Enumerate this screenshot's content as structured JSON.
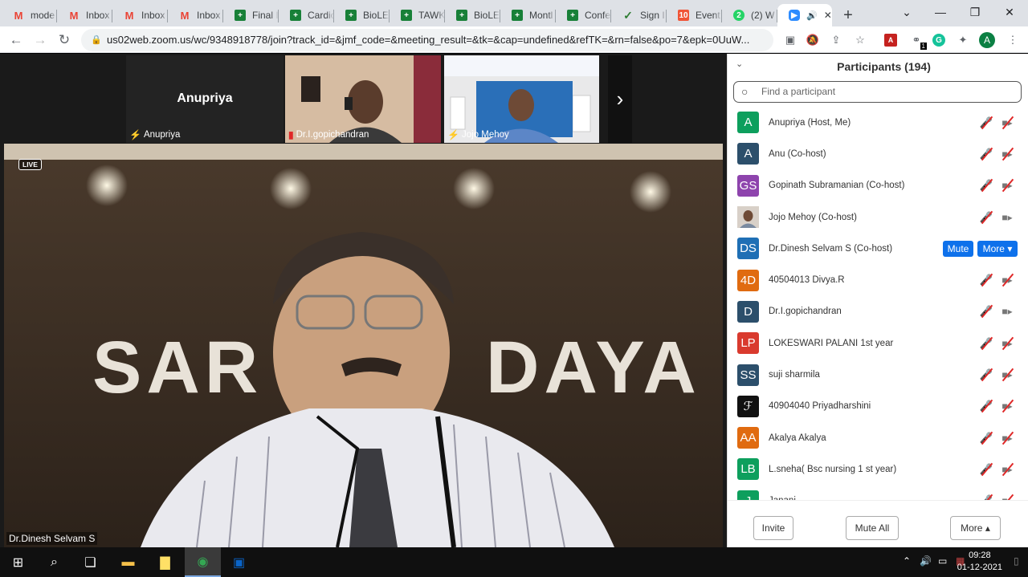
{
  "browser": {
    "tabs": [
      {
        "title": "mode",
        "favicon": "gmail-icon",
        "glyph": "M",
        "kind": "gmail"
      },
      {
        "title": "Inbox",
        "favicon": "gmail-icon",
        "glyph": "M",
        "kind": "gmail"
      },
      {
        "title": "Inbox",
        "favicon": "gmail-icon",
        "glyph": "M",
        "kind": "gmail"
      },
      {
        "title": "Inbox",
        "favicon": "gmail-icon",
        "glyph": "M",
        "kind": "gmail"
      },
      {
        "title": "Final I",
        "favicon": "sheets-icon",
        "glyph": "+",
        "kind": "sheet"
      },
      {
        "title": "Cardic",
        "favicon": "sheets-icon",
        "glyph": "+",
        "kind": "sheet"
      },
      {
        "title": "BioLE",
        "favicon": "sheets-icon",
        "glyph": "+",
        "kind": "sheet"
      },
      {
        "title": "TAWK",
        "favicon": "sheets-icon",
        "glyph": "+",
        "kind": "sheet"
      },
      {
        "title": "BioLE",
        "favicon": "sheets-icon",
        "glyph": "+",
        "kind": "sheet"
      },
      {
        "title": "Montl",
        "favicon": "sheets-icon",
        "glyph": "+",
        "kind": "sheet"
      },
      {
        "title": "Confe",
        "favicon": "sheets-icon",
        "glyph": "+",
        "kind": "sheet"
      },
      {
        "title": "Sign I",
        "favicon": "signup-icon",
        "glyph": "✓",
        "kind": "sign"
      },
      {
        "title": "Event",
        "favicon": "event-icon",
        "glyph": "10",
        "kind": "event"
      },
      {
        "title": "(2) W",
        "favicon": "whatsapp-icon",
        "glyph": "2",
        "kind": "wa"
      }
    ],
    "active_tab": {
      "favicon": "zoom-icon",
      "speaker": "🔊",
      "close": "✕"
    },
    "new_tab": "+",
    "url": "us02web.zoom.us/wc/9348918778/join?track_id=&jmf_code=&meeting_result=&tk=&cap=undefined&refTK=&rn=false&po=7&epk=0UuW...",
    "profile_initial": "A",
    "ext_badge": "1"
  },
  "meeting": {
    "thumbnails": [
      {
        "name": "Anupriya",
        "big_label": "Anupriya"
      },
      {
        "name": "Dr.I.gopichandran"
      },
      {
        "name": "Jojo Mehoy"
      }
    ],
    "live_badge": "LIVE",
    "active_speaker": "Dr.Dinesh Selvam S"
  },
  "participants": {
    "title": "Participants (194)",
    "search_placeholder": "Find a participant",
    "list": [
      {
        "initials": "A",
        "color": "#0d9f5d",
        "name": "Anupriya (Host, Me)",
        "mic": "muted",
        "cam": "off"
      },
      {
        "initials": "A",
        "color": "#2c4f6b",
        "name": "Anu (Co-host)",
        "mic": "muted",
        "cam": "off"
      },
      {
        "initials": "GS",
        "color": "#8e44ad",
        "name": "Gopinath Subramanian (Co-host)",
        "mic": "muted",
        "cam": "off"
      },
      {
        "initials": "",
        "color": "#8a7a70",
        "name": "Jojo Mehoy (Co-host)",
        "mic": "muted",
        "cam": "on",
        "photo": true
      },
      {
        "initials": "DS",
        "color": "#1f6fb5",
        "name": "Dr.Dinesh Selvam S (Co-host)",
        "buttons": [
          "Mute",
          "More ▾"
        ]
      },
      {
        "initials": "4D",
        "color": "#e06b10",
        "name": "40504013 Divya.R",
        "mic": "muted",
        "cam": "off"
      },
      {
        "initials": "D",
        "color": "#2c4f6b",
        "name": "Dr.I.gopichandran",
        "mic": "muted",
        "cam": "on"
      },
      {
        "initials": "LP",
        "color": "#d93a2e",
        "name": "LOKESWARI PALANI 1st year",
        "mic": "muted",
        "cam": "off"
      },
      {
        "initials": "SS",
        "color": "#2c4f6b",
        "name": "suji sharmila",
        "mic": "muted",
        "cam": "off"
      },
      {
        "initials": "ℱ",
        "color": "#111111",
        "name": "40904040 Priyadharshini",
        "mic": "muted",
        "cam": "off"
      },
      {
        "initials": "AA",
        "color": "#e06b10",
        "name": "Akalya Akalya",
        "mic": "muted",
        "cam": "off"
      },
      {
        "initials": "LB",
        "color": "#0d9f5d",
        "name": "L.sneha( Bsc nursing 1 st year)",
        "mic": "muted",
        "cam": "off"
      },
      {
        "initials": "J",
        "color": "#0d9f5d",
        "name": "Janani",
        "mic": "muted",
        "cam": "off"
      }
    ],
    "footer": {
      "invite": "Invite",
      "mute_all": "Mute All",
      "more": "More ▴"
    }
  },
  "taskbar": {
    "time": "09:28",
    "date": "01-12-2021"
  }
}
